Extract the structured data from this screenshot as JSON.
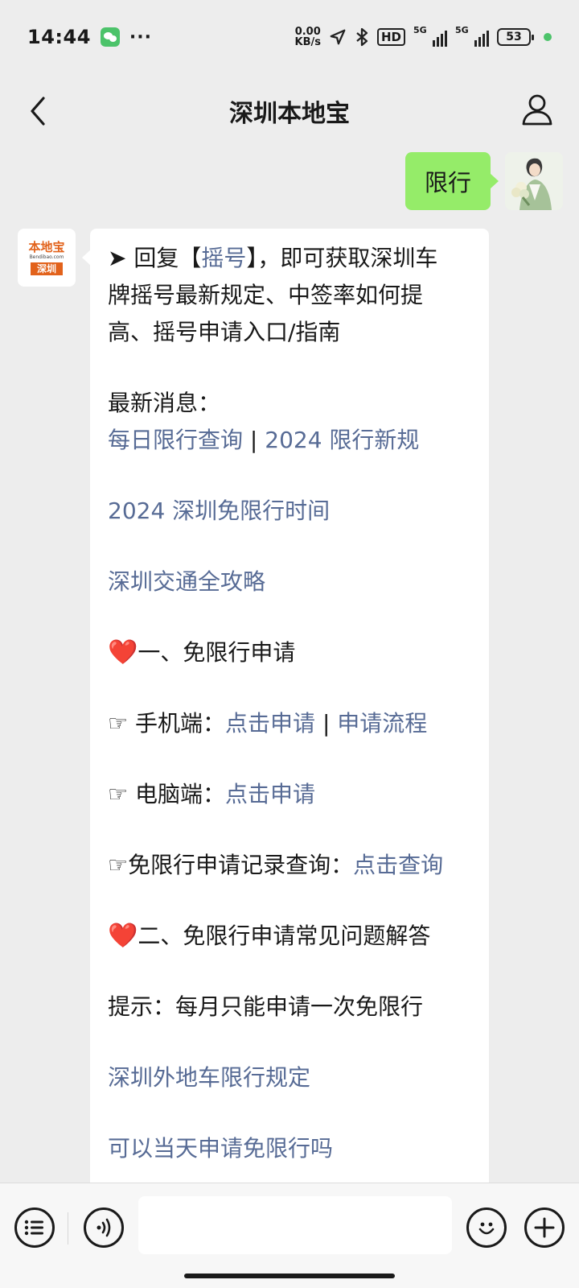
{
  "status_bar": {
    "time": "14:44",
    "net_speed_value": "0.00",
    "net_speed_unit": "KB/s",
    "hd_label": "HD",
    "signal1_label": "5G",
    "signal2_label": "5G",
    "battery": "53",
    "icons": [
      "wechat-icon",
      "more-dots-icon",
      "location-arrow-icon",
      "bluetooth-icon",
      "hd-icon",
      "signal-icon",
      "battery-icon"
    ],
    "dots": "···"
  },
  "nav": {
    "title": "深圳本地宝"
  },
  "outgoing_message": {
    "text": "限行"
  },
  "bot": {
    "avatar_top": "本地宝",
    "avatar_url": "Bendibao.com",
    "avatar_bottom": "深圳"
  },
  "incoming_message": {
    "intro_prefix": "➤ 回复【",
    "intro_keyword": "摇号",
    "intro_suffix_1": "】，即可获取深圳车",
    "intro_line_2": "牌摇号最新规定、中签率如何提",
    "intro_line_3": "高、摇号申请入口/指南",
    "latest_label": "最新消息：",
    "link_daily_query": "每日限行查询",
    "separator": " | ",
    "link_2024_rules": "2024 限行新规",
    "link_2024_exempt_time": "2024 深圳免限行时间",
    "link_traffic_guide": "深圳交通全攻略",
    "heart_emoji": "❤️",
    "section1_title": "一、免限行申请",
    "hand_emoji": "☞",
    "mobile_label": "手机端：",
    "mobile_apply_link": "点击申请",
    "mobile_process_link": "申请流程",
    "pc_label": "电脑端：",
    "pc_apply_link": "点击申请",
    "record_label": "免限行申请记录查询：",
    "record_query_link": "点击查询",
    "section2_title": "二、免限行申请常见问题解答",
    "tip": "提示：每月只能申请一次免限行",
    "link_nonlocal_rules": "深圳外地车限行规定",
    "link_same_day": "可以当天申请免限行吗"
  },
  "toolbar": {
    "input_value": ""
  },
  "colors": {
    "background": "#ededed",
    "outgoing_bubble": "#95ec69",
    "incoming_bubble": "#ffffff",
    "link": "#576b95",
    "brand_orange": "#e2621b"
  }
}
